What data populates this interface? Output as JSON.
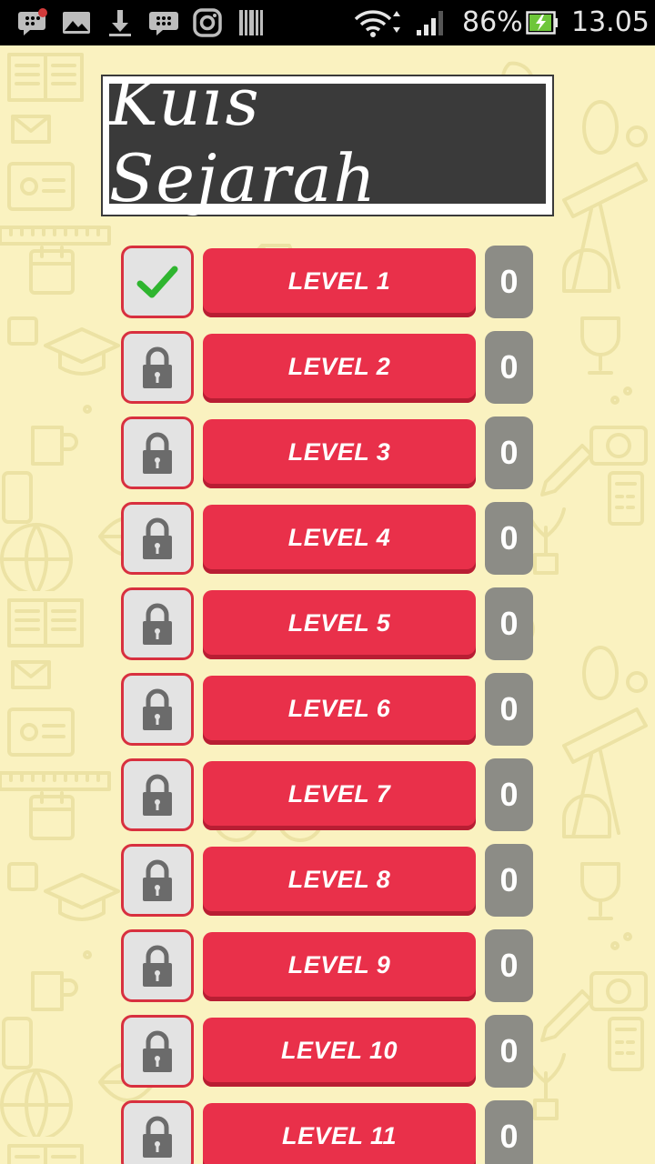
{
  "status_bar": {
    "battery": "86%",
    "time": "13.05",
    "icons_left": [
      "bbm-notification-icon",
      "gallery-icon",
      "download-icon",
      "bbm-icon",
      "instagram-icon",
      "barcode-icon"
    ],
    "icons_right": [
      "wifi-icon",
      "signal-icon",
      "battery-charging-icon"
    ]
  },
  "title": "Kuis Sejarah",
  "levels": [
    {
      "label": "LEVEL 1",
      "score": "0",
      "status": "check-icon"
    },
    {
      "label": "LEVEL 2",
      "score": "0",
      "status": "lock-icon"
    },
    {
      "label": "LEVEL 3",
      "score": "0",
      "status": "lock-icon"
    },
    {
      "label": "LEVEL 4",
      "score": "0",
      "status": "lock-icon"
    },
    {
      "label": "LEVEL 5",
      "score": "0",
      "status": "lock-icon"
    },
    {
      "label": "LEVEL 6",
      "score": "0",
      "status": "lock-icon"
    },
    {
      "label": "LEVEL 7",
      "score": "0",
      "status": "lock-icon"
    },
    {
      "label": "LEVEL 8",
      "score": "0",
      "status": "lock-icon"
    },
    {
      "label": "LEVEL 9",
      "score": "0",
      "status": "lock-icon"
    },
    {
      "label": "LEVEL 10",
      "score": "0",
      "status": "lock-icon"
    },
    {
      "label": "LEVEL 11",
      "score": "0",
      "status": "lock-icon"
    }
  ],
  "colors": {
    "background": "#faf2c0",
    "doodle": "#ece2a4",
    "level_button": "#e9304a",
    "status_border": "#d8303f",
    "score_box": "#8c8c86",
    "check": "#2fb52f",
    "lock": "#6b6b6b"
  }
}
